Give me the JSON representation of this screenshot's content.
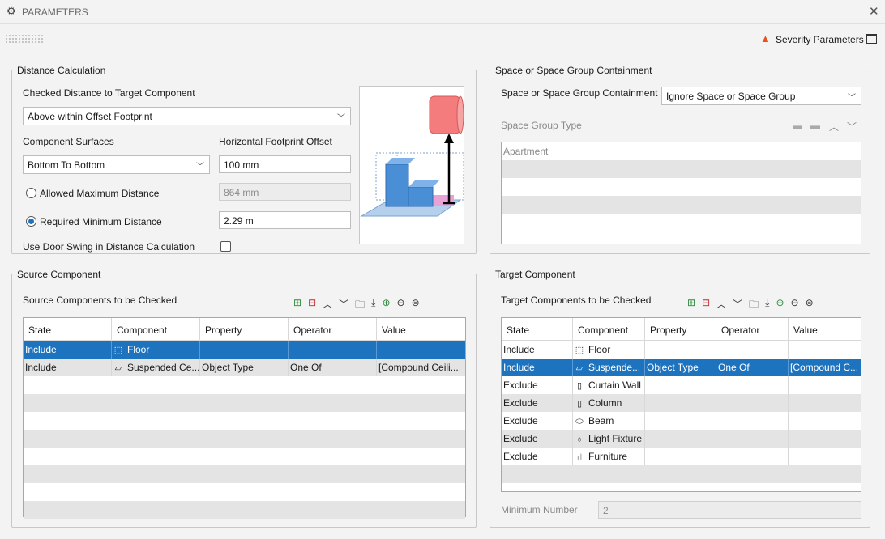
{
  "window": {
    "title": "PARAMETERS",
    "severity_label": "Severity Parameters"
  },
  "distance": {
    "legend": "Distance Calculation",
    "checked_label": "Checked Distance to Target Component",
    "checked_value": "Above within Offset Footprint",
    "surfaces_label": "Component Surfaces",
    "surfaces_value": "Bottom To Bottom",
    "offset_label": "Horizontal Footprint Offset",
    "offset_value": "100 mm",
    "allowed_label": "Allowed Maximum Distance",
    "allowed_value": "864 mm",
    "required_label": "Required Minimum Distance",
    "required_value": "2.29 m",
    "door_label": "Use Door Swing in Distance Calculation"
  },
  "space": {
    "legend": "Space or Space Group Containment",
    "containment_label": "Space or Space Group Containment",
    "containment_value": "Ignore Space or Space Group",
    "group_type_label": "Space Group Type",
    "list": [
      "Apartment",
      "",
      "",
      "",
      ""
    ]
  },
  "source": {
    "legend": "Source Component",
    "list_label": "Source Components to be Checked",
    "columns": [
      "State",
      "Component",
      "Property",
      "Operator",
      "Value"
    ],
    "rows": [
      {
        "state": "Include",
        "component": "Floor",
        "icon": "floor-icon",
        "property": "",
        "operator": "",
        "value": ""
      },
      {
        "state": "Include",
        "component": "Suspended Ce...",
        "icon": "ceiling-icon",
        "property": "Object Type",
        "operator": "One Of",
        "value": "[Compound Ceili..."
      }
    ]
  },
  "target": {
    "legend": "Target Component",
    "list_label": "Target Components to be Checked",
    "columns": [
      "State",
      "Component",
      "Property",
      "Operator",
      "Value"
    ],
    "rows": [
      {
        "state": "Include",
        "component": "Floor",
        "icon": "floor-icon",
        "property": "",
        "operator": "",
        "value": ""
      },
      {
        "state": "Include",
        "component": "Suspende...",
        "icon": "ceiling-icon",
        "property": "Object Type",
        "operator": "One Of",
        "value": "[Compound C..."
      },
      {
        "state": "Exclude",
        "component": "Curtain Wall",
        "icon": "curtain-wall-icon",
        "property": "",
        "operator": "",
        "value": ""
      },
      {
        "state": "Exclude",
        "component": "Column",
        "icon": "column-icon",
        "property": "",
        "operator": "",
        "value": ""
      },
      {
        "state": "Exclude",
        "component": "Beam",
        "icon": "beam-icon",
        "property": "",
        "operator": "",
        "value": ""
      },
      {
        "state": "Exclude",
        "component": "Light Fixture",
        "icon": "light-fixture-icon",
        "property": "",
        "operator": "",
        "value": ""
      },
      {
        "state": "Exclude",
        "component": "Furniture",
        "icon": "furniture-icon",
        "property": "",
        "operator": "",
        "value": ""
      }
    ],
    "min_label": "Minimum Number",
    "min_value": "2"
  },
  "colors": {
    "selection": "#1e73be",
    "target_object": "#f47c7c",
    "source_object": "#4a8fd6"
  }
}
